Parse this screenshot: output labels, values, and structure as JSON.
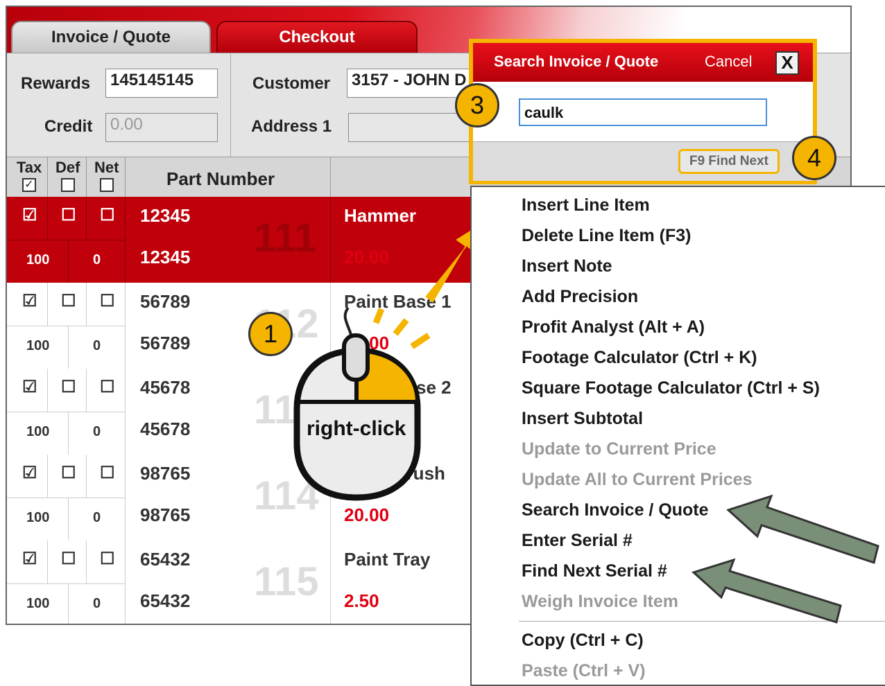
{
  "tabs": {
    "invoice": "Invoice / Quote",
    "checkout": "Checkout"
  },
  "header": {
    "rewards_label": "Rewards",
    "rewards_value": "145145145",
    "credit_label": "Credit",
    "credit_value": "0.00",
    "customer_label": "Customer",
    "customer_value": "3157 - JOHN D",
    "address_label": "Address 1",
    "address_value": ""
  },
  "grid": {
    "headers": {
      "tax": "Tax",
      "def": "Def",
      "net": "Net",
      "part": "Part Number"
    },
    "rows": [
      {
        "part": "12345",
        "part2": "12345",
        "num": "111",
        "desc": "Hammer",
        "price": "20.00",
        "qty": "100",
        "qty2": "0",
        "tax": "☑",
        "def": "☐",
        "net": "☐"
      },
      {
        "part": "56789",
        "part2": "56789",
        "num": "112",
        "desc": "Paint Base 1",
        "price": "20.00",
        "qty": "100",
        "qty2": "0",
        "tax": "☑",
        "def": "☐",
        "net": "☐"
      },
      {
        "part": "45678",
        "part2": "45678",
        "num": "113",
        "desc": "Paint Base 2",
        "price": "",
        "qty": "100",
        "qty2": "0",
        "tax": "☑",
        "def": "☐",
        "net": "☐"
      },
      {
        "part": "98765",
        "part2": "98765",
        "num": "114",
        "desc": "Paint Brush",
        "price": "20.00",
        "qty": "100",
        "qty2": "0",
        "tax": "☑",
        "def": "☐",
        "net": "☐"
      },
      {
        "part": "65432",
        "part2": "65432",
        "num": "115",
        "desc": "Paint Tray",
        "price": "2.50",
        "qty": "100",
        "qty2": "0",
        "tax": "☑",
        "def": "☐",
        "net": "☐"
      }
    ]
  },
  "dialog": {
    "title": "Search Invoice / Quote",
    "cancel": "Cancel",
    "close": "X",
    "input_value": "caulk",
    "find_next": "F9 Find Next"
  },
  "context_menu": {
    "items": [
      {
        "label": "Insert Line Item",
        "enabled": true
      },
      {
        "label": "Delete Line Item (F3)",
        "enabled": true
      },
      {
        "label": "Insert Note",
        "enabled": true
      },
      {
        "label": "Add Precision",
        "enabled": true
      },
      {
        "label": "Profit Analyst (Alt + A)",
        "enabled": true
      },
      {
        "label": "Footage Calculator (Ctrl + K)",
        "enabled": true
      },
      {
        "label": "Square Footage Calculator (Ctrl + S)",
        "enabled": true
      },
      {
        "label": "Insert Subtotal",
        "enabled": true
      },
      {
        "label": "Update to Current Price",
        "enabled": false
      },
      {
        "label": "Update All to Current Prices",
        "enabled": false
      },
      {
        "label": "Search Invoice / Quote",
        "enabled": true
      },
      {
        "label": "Enter Serial #",
        "enabled": true
      },
      {
        "label": "Find Next Serial #",
        "enabled": true
      },
      {
        "label": "Weigh Invoice Item",
        "enabled": false
      },
      {
        "label": "Copy (Ctrl + C)",
        "enabled": true
      },
      {
        "label": "Paste (Ctrl + V)",
        "enabled": false
      }
    ]
  },
  "callouts": {
    "step1": "1",
    "step3": "3",
    "step4": "4",
    "mouse_label": "right-click"
  },
  "colors": {
    "accent_red": "#c0000a",
    "highlight_yellow": "#f5b400",
    "arrow_green": "#7a8f78"
  }
}
